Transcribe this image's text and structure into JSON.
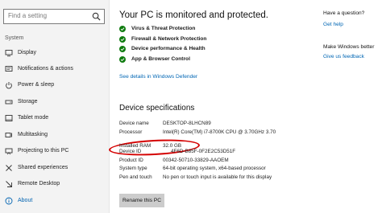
{
  "search": {
    "placeholder": "Find a setting"
  },
  "sidebar": {
    "section": "System",
    "items": [
      {
        "label": "Display",
        "icon": "display-icon"
      },
      {
        "label": "Notifications & actions",
        "icon": "notifications-icon"
      },
      {
        "label": "Power & sleep",
        "icon": "power-icon"
      },
      {
        "label": "Storage",
        "icon": "storage-icon"
      },
      {
        "label": "Tablet mode",
        "icon": "tablet-icon"
      },
      {
        "label": "Multitasking",
        "icon": "multitasking-icon"
      },
      {
        "label": "Projecting to this PC",
        "icon": "projecting-icon"
      },
      {
        "label": "Shared experiences",
        "icon": "shared-icon"
      },
      {
        "label": "Remote Desktop",
        "icon": "remote-desktop-icon"
      },
      {
        "label": "About",
        "icon": "info-icon",
        "active": true
      }
    ]
  },
  "protection": {
    "title": "Your PC is monitored and protected.",
    "items": [
      "Virus & Threat Protection",
      "Firewall & Network Protection",
      "Device performance & Health",
      "App & Browser Control"
    ],
    "link": "See details in Windows Defender"
  },
  "specs": {
    "title": "Device specifications",
    "rows": [
      {
        "label": "Device name",
        "value": "DESKTOP-8LHCN89"
      },
      {
        "label": "Processor",
        "value": "Intel(R) Core(TM) i7-8700K CPU @ 3.70GHz   3.70"
      },
      {
        "label": "Installed RAM",
        "value": "32.0 GB"
      },
      {
        "label": "Device ID",
        "value": "4F6D-B85F-0F2E2C53D51F"
      },
      {
        "label": "Product ID",
        "value": "00342-50710-33829-AAOEM"
      },
      {
        "label": "System type",
        "value": "64-bit operating system, x64-based processor"
      },
      {
        "label": "Pen and touch",
        "value": "No pen or touch input is available for this display"
      }
    ],
    "rename_label": "Rename this PC"
  },
  "help": {
    "question_title": "Have a question?",
    "get_help": "Get help",
    "better_title": "Make Windows better",
    "feedback": "Give us feedback"
  },
  "colors": {
    "accent": "#0066b4",
    "check": "#107c10",
    "highlight": "#d40000",
    "sidebar_bg": "#f3f3f3"
  }
}
